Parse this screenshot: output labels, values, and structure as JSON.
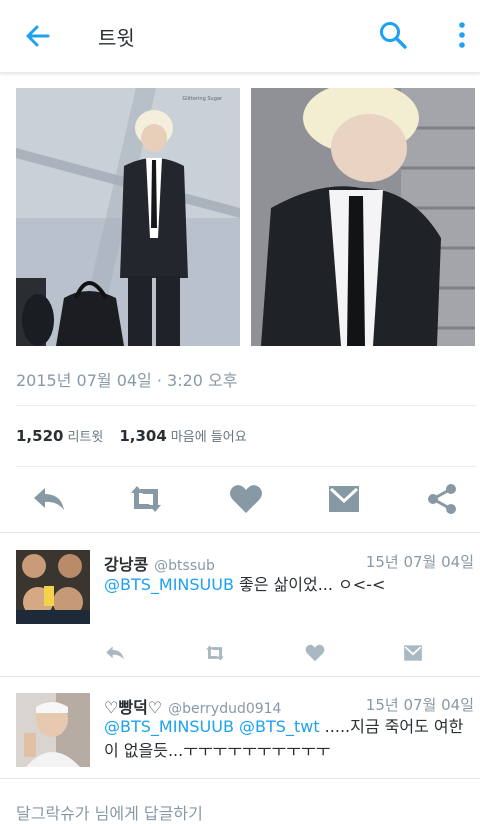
{
  "appbar": {
    "title": "트윗",
    "back_icon": "arrow-left-icon",
    "search_icon": "search-icon",
    "more_icon": "more-vertical-icon",
    "accent": "#1da1f2"
  },
  "tweet": {
    "timestamp": "2015년 07월 04일 · 3:20 오후",
    "retweets_count": "1,520",
    "retweets_label": "리트윗",
    "likes_count": "1,304",
    "likes_label": "마음에 들어요",
    "media": [
      {
        "name": "photo-left",
        "watermark": "Glittering Sugar"
      },
      {
        "name": "photo-right"
      }
    ]
  },
  "actions": [
    "reply-icon",
    "retweet-icon",
    "heart-icon",
    "message-icon",
    "share-icon"
  ],
  "replies": [
    {
      "name": "강낭콩",
      "handle": "@btssub",
      "date": "15년 07월 04일",
      "mention": "@BTS_MINSUUB",
      "text": " 좋은 삶이었... ㅇ<-<"
    },
    {
      "name": "♡빵덕♡",
      "handle": "@berrydud0914",
      "date": "15년 07월 04일",
      "mention": "@BTS_MINSUUB",
      "mention2": "@BTS_twt",
      "text": " .....지금 죽어도 여한이 없을듯...ㅜㅜㅜㅜㅜㅜㅜㅜㅜㅜ"
    }
  ],
  "reply_box": {
    "placeholder": "달그락슈가 님에게 답글하기"
  }
}
